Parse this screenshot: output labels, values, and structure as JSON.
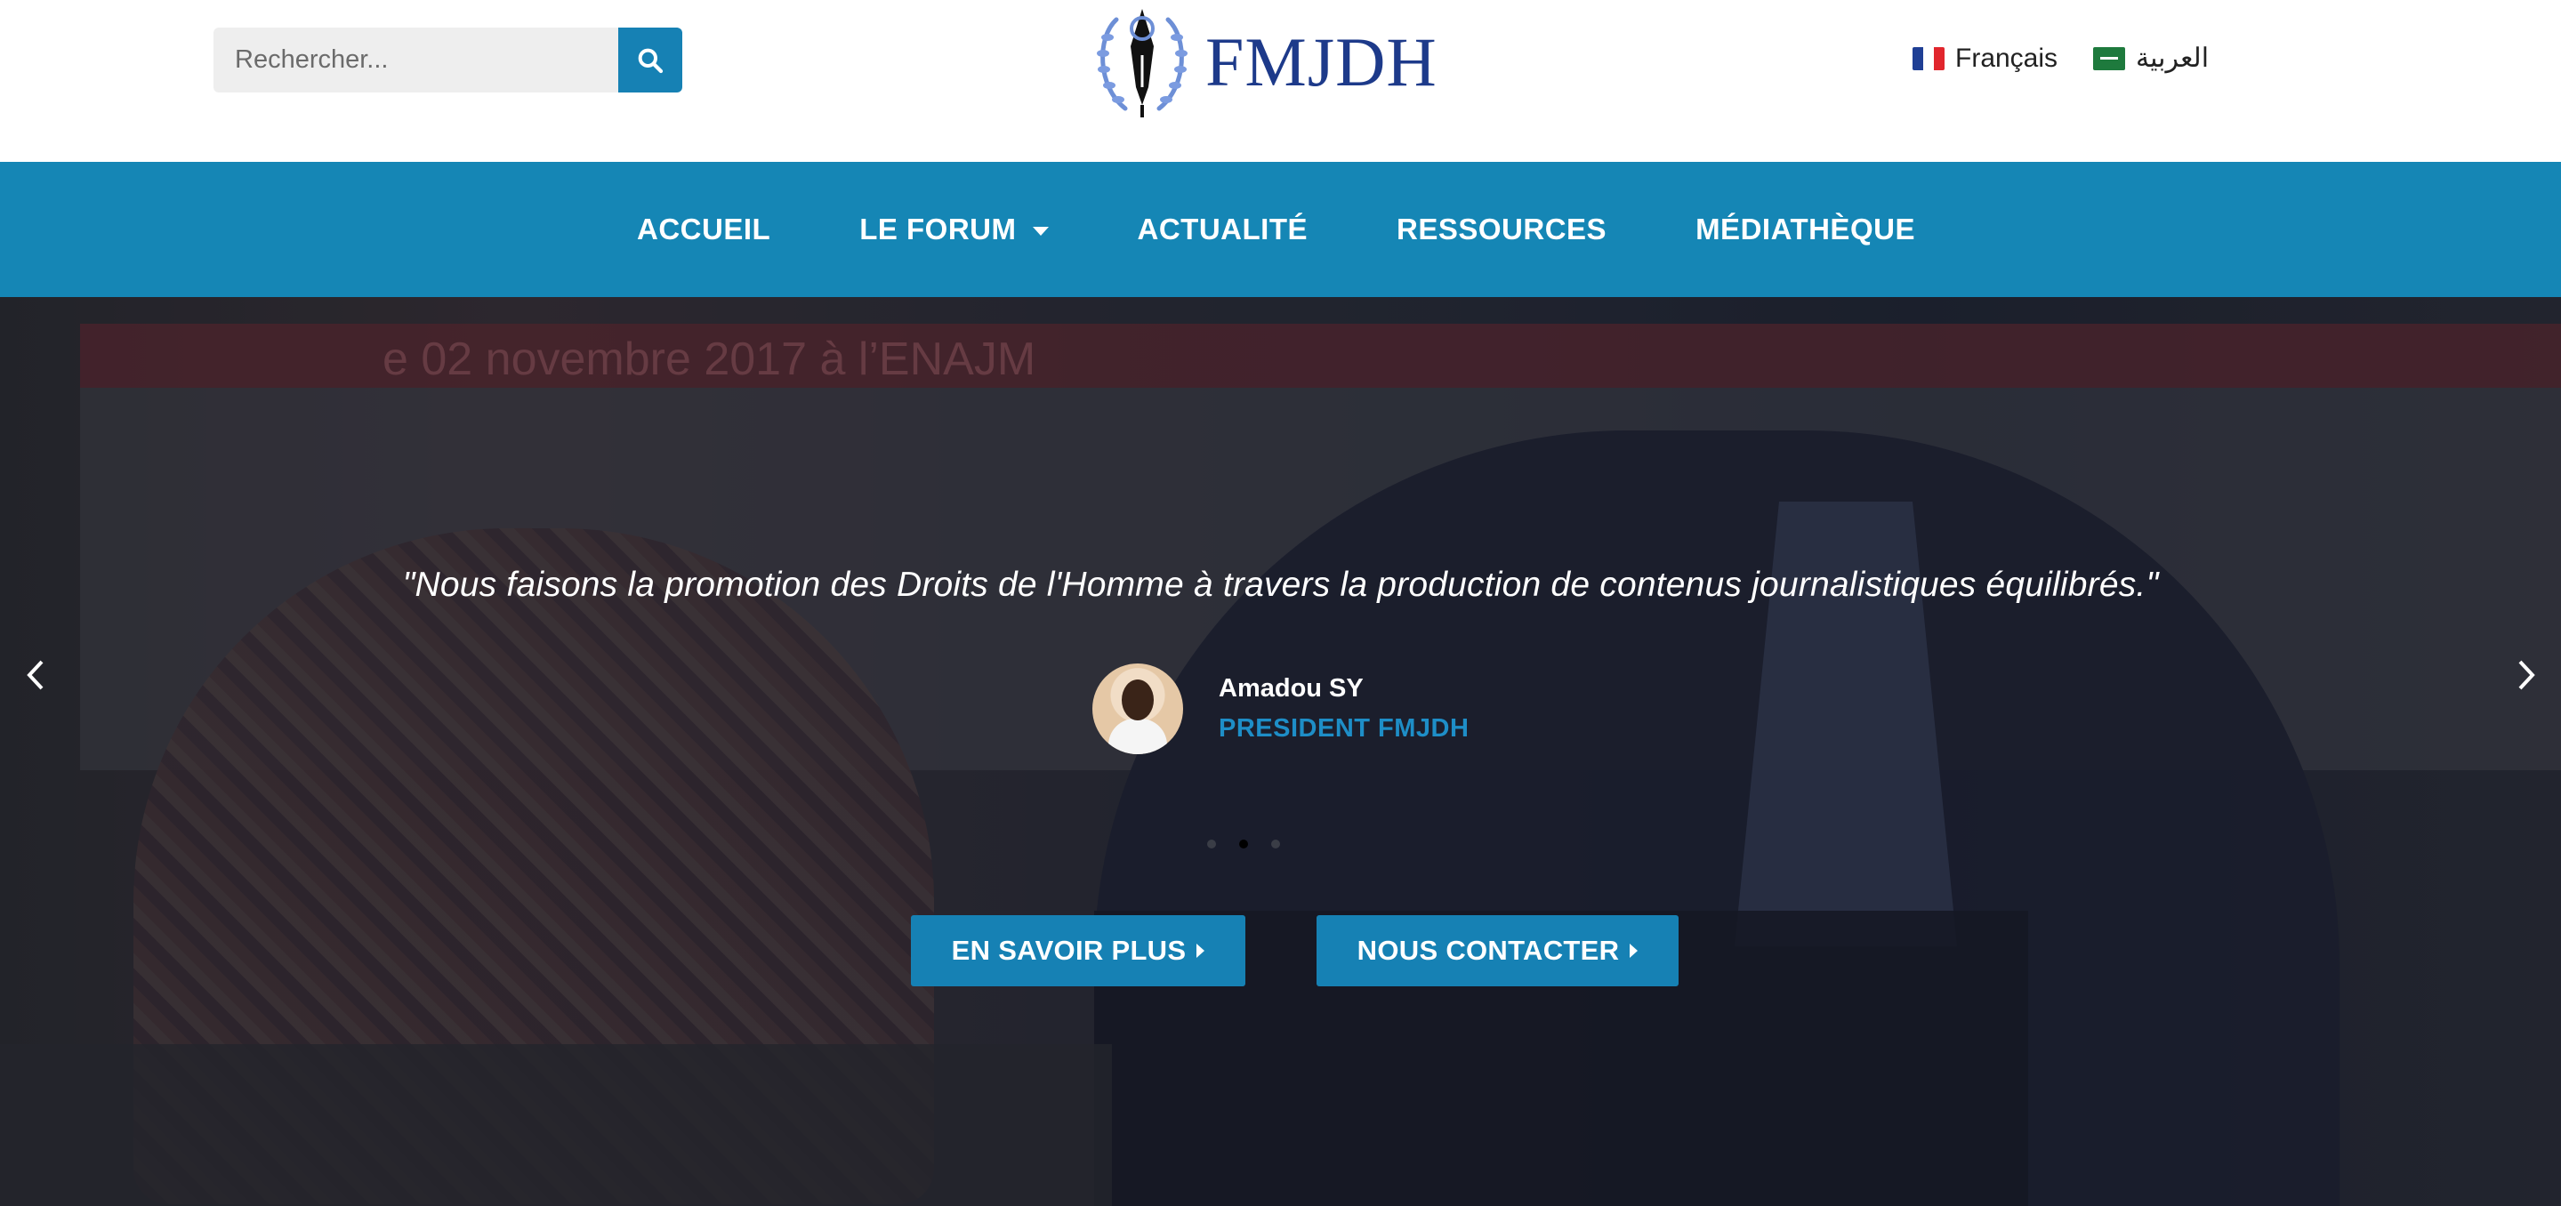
{
  "header": {
    "search": {
      "placeholder": "Rechercher..."
    },
    "logo": {
      "text": "FMJDH"
    },
    "languages": [
      {
        "label": "Français"
      },
      {
        "label": "العربية"
      }
    ]
  },
  "nav": {
    "items": [
      {
        "label": "ACCUEIL"
      },
      {
        "label": "LE FORUM"
      },
      {
        "label": "ACTUALITÉ"
      },
      {
        "label": "RESSOURCES"
      },
      {
        "label": "MÉDIATHÈQUE"
      }
    ]
  },
  "hero": {
    "background_text": "e 02 novembre 2017 à l’ENAJM",
    "quote": "\"Nous faisons la promotion des Droits de l'Homme à travers la production de contenus journalistiques équilibrés.\"",
    "author": {
      "name": "Amadou SY",
      "role": "PRESIDENT FMJDH"
    },
    "slides": {
      "count": 3,
      "active": 1
    },
    "buttons": [
      {
        "label": "EN SAVOIR PLUS"
      },
      {
        "label": "NOUS CONTACTER"
      }
    ]
  },
  "colors": {
    "primary": "#1586b5",
    "accent_text": "#1e8ec7",
    "logo_blue": "#1d3a8a"
  }
}
